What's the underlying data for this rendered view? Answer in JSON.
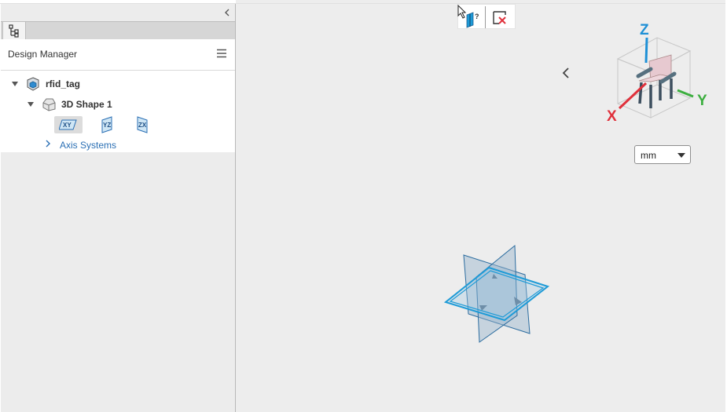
{
  "panel": {
    "title": "Design Manager",
    "collapse_icon": "chevron-left-icon",
    "tab_icon": "tree-icon",
    "menu_icon": "hamburger-icon"
  },
  "tree": {
    "root": {
      "label": "rfid_tag",
      "icon": "assembly-icon",
      "expanded": true
    },
    "shape": {
      "label": "3D Shape 1",
      "icon": "part-icon",
      "expanded": true
    },
    "planes": [
      {
        "label": "XY",
        "icon": "xy-plane-icon",
        "selected": true
      },
      {
        "label": "YZ",
        "icon": "yz-plane-icon",
        "selected": false
      },
      {
        "label": "ZX",
        "icon": "zx-plane-icon",
        "selected": false
      }
    ],
    "axis_systems": {
      "label": "Axis Systems",
      "expanded": false
    }
  },
  "toolbar": {
    "help_icon": "help-cursor-icon",
    "exit_icon": "exit-sketch-icon"
  },
  "viewport": {
    "unit": "mm",
    "unit_options": [
      "mm"
    ],
    "viewcube": {
      "x_label": "X",
      "y_label": "Y",
      "z_label": "Z"
    },
    "back_icon": "chevron-left-icon"
  },
  "colors": {
    "accent": "#2a6fb4",
    "plane_blue": "#1e9bd7",
    "axis_x": "#e0303b",
    "axis_y": "#3cae3f",
    "axis_z": "#1e90d6"
  }
}
